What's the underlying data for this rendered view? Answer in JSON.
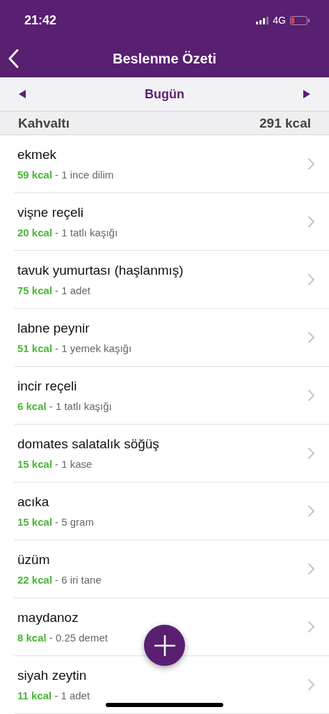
{
  "status_bar": {
    "time": "21:42",
    "network": "4G"
  },
  "nav": {
    "title": "Beslenme Özeti"
  },
  "date_bar": {
    "label": "Bugün"
  },
  "section": {
    "title": "Kahvaltı",
    "total": "291 kcal"
  },
  "items": [
    {
      "name": "ekmek",
      "kcal": "59 kcal",
      "portion": "- 1 ince dilim"
    },
    {
      "name": "vişne reçeli",
      "kcal": "20 kcal",
      "portion": "- 1 tatlı kaşığı"
    },
    {
      "name": "tavuk yumurtası (haşlanmış)",
      "kcal": "75 kcal",
      "portion": "- 1 adet"
    },
    {
      "name": "labne peynir",
      "kcal": "51 kcal",
      "portion": "- 1 yemek kaşığı"
    },
    {
      "name": "incir reçeli",
      "kcal": "6 kcal",
      "portion": "- 1 tatlı kaşığı"
    },
    {
      "name": "domates salatalık söğüş",
      "kcal": "15 kcal",
      "portion": "- 1 kase"
    },
    {
      "name": "acıka",
      "kcal": "15 kcal",
      "portion": "- 5 gram"
    },
    {
      "name": "üzüm",
      "kcal": "22 kcal",
      "portion": "- 6 iri tane"
    },
    {
      "name": "maydanoz",
      "kcal": "8 kcal",
      "portion": "- 0.25 demet"
    },
    {
      "name": "siyah zeytin",
      "kcal": "11 kcal",
      "portion": "- 1 adet"
    }
  ]
}
